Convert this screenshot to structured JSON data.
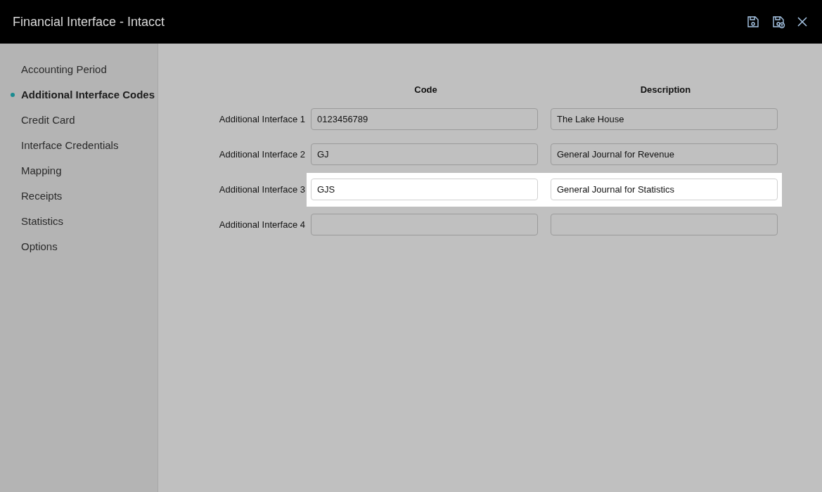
{
  "window": {
    "title": "Financial Interface - Intacct"
  },
  "sidebar": {
    "items": [
      {
        "label": "Accounting Period",
        "selected": false
      },
      {
        "label": "Additional Interface Codes",
        "selected": true
      },
      {
        "label": "Credit Card",
        "selected": false
      },
      {
        "label": "Interface Credentials",
        "selected": false
      },
      {
        "label": "Mapping",
        "selected": false
      },
      {
        "label": "Receipts",
        "selected": false
      },
      {
        "label": "Statistics",
        "selected": false
      },
      {
        "label": "Options",
        "selected": false
      }
    ]
  },
  "table": {
    "columns": [
      "Code",
      "Description"
    ],
    "rows": [
      {
        "label": "Additional Interface 1",
        "code": "0123456789",
        "description": "The Lake House",
        "highlighted": false
      },
      {
        "label": "Additional Interface 2",
        "code": "GJ",
        "description": "General Journal for Revenue",
        "highlighted": false
      },
      {
        "label": "Additional Interface 3",
        "code": "GJS",
        "description": "General Journal for Statistics",
        "highlighted": true
      },
      {
        "label": "Additional Interface 4",
        "highlighted": false
      }
    ]
  }
}
